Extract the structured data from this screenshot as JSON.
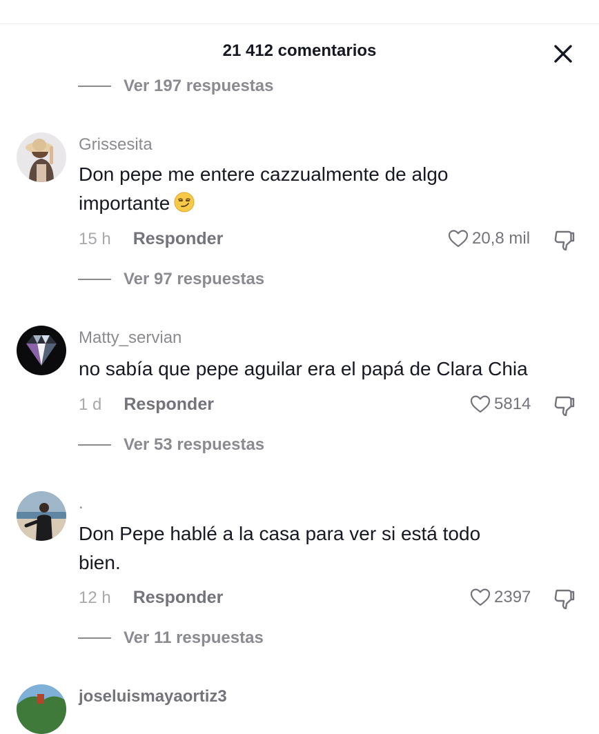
{
  "header": {
    "title": "21 412 comentarios",
    "close_icon": "close-icon"
  },
  "top_replies": {
    "label": "Ver 197 respuestas"
  },
  "comments": [
    {
      "username": "Grissesita",
      "text_line1": "Don pepe me entere cazzualmente de algo",
      "text_line2": "importante",
      "emoji": "smirk-emoji",
      "time": "15 h",
      "reply_label": "Responder",
      "likes": "20,8 mil",
      "replies": "Ver 97 respuestas"
    },
    {
      "username": "Matty_servian",
      "text_line1": "no sabía que pepe aguilar era el papá de Clara Chia",
      "time": "1 d",
      "reply_label": "Responder",
      "likes": "5814",
      "replies": "Ver 53 respuestas"
    },
    {
      "username": ".",
      "text_line1": "Don Pepe hablé a la casa para ver si está todo",
      "text_line2": "bien.",
      "time": "12 h",
      "reply_label": "Responder",
      "likes": "2397",
      "replies": "Ver 11 respuestas"
    },
    {
      "username": "joseluismayaortiz3"
    }
  ],
  "colors": {
    "primary_text": "#161823",
    "secondary_text": "#8a8b91",
    "background": "#ffffff"
  }
}
